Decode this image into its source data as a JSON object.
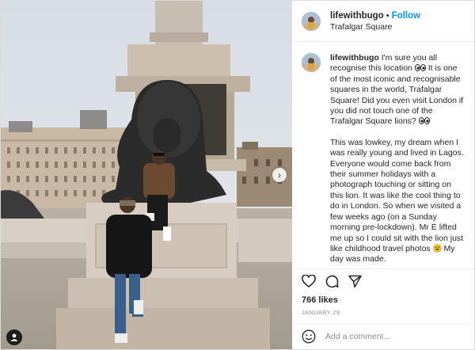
{
  "header": {
    "username": "lifewithbugo",
    "separator": "•",
    "follow_label": "Follow",
    "location": "Trafalgar Square"
  },
  "caption": {
    "username": "lifewithbugo",
    "para1_a": " I'm sure you all recognise this location ",
    "para1_b": " It is one of the most iconic and recognisable squares in the world, Trafalgar Square! Did you even visit London if you did not touch one of the Trafalgar Square lions? ",
    "para2_a": "This was lowkey, my dream when I was really young and lived in Lagos. Everyone would come back from their summer holidays with a photograph touching or sitting on this lion. It was like the cool thing to do in London. So when we visited a few weeks ago (on a Sunday morning pre-lockdown). Mr E lifted me up so I could sit with the lion just like childhood travel photos ",
    "para2_b": " My day was made."
  },
  "actions": {
    "like_icon": "heart-icon",
    "comment_icon": "comment-icon",
    "share_icon": "share-icon"
  },
  "likes": "766 likes",
  "date": "JANUARY 29",
  "comment": {
    "placeholder": "Add a comment...",
    "emoji_icon": "emoji-icon"
  },
  "media": {
    "next_icon": "chevron-right-icon",
    "tag_icon": "user-tag-icon"
  }
}
